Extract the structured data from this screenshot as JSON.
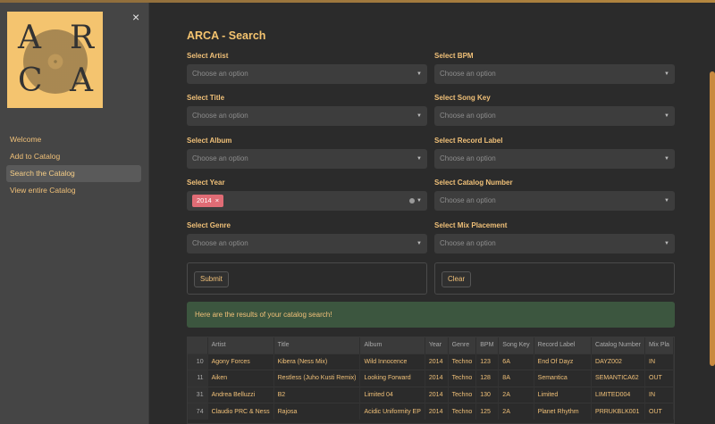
{
  "sidebar": {
    "logo_letters": [
      "A",
      "R",
      "C",
      "A"
    ],
    "nav": [
      {
        "label": "Welcome"
      },
      {
        "label": "Add to Catalog"
      },
      {
        "label": "Search the Catalog"
      },
      {
        "label": "View entire Catalog"
      }
    ],
    "close_icon": "×"
  },
  "main": {
    "title": "ARCA - Search",
    "placeholder": "Choose an option",
    "left_fields": [
      {
        "label": "Select Artist"
      },
      {
        "label": "Select Title"
      },
      {
        "label": "Select Album"
      },
      {
        "label": "Select Year"
      },
      {
        "label": "Select Genre"
      }
    ],
    "right_fields": [
      {
        "label": "Select BPM"
      },
      {
        "label": "Select Song Key"
      },
      {
        "label": "Select Record Label"
      },
      {
        "label": "Select Catalog Number"
      },
      {
        "label": "Select Mix Placement"
      }
    ],
    "year_tag": "2014",
    "submit_label": "Submit",
    "clear_label": "Clear",
    "success_message": "Here are the results of your catalog search!"
  },
  "table": {
    "columns": [
      "",
      "Artist",
      "Title",
      "Album",
      "Year",
      "Genre",
      "BPM",
      "Song Key",
      "Record Label",
      "Catalog Number",
      "Mix Pla"
    ],
    "rows": [
      [
        "10",
        "Agony Forces",
        "Kibera (Ness Mix)",
        "Wild Innocence",
        "2014",
        "Techno",
        "123",
        "6A",
        "End Of Dayz",
        "DAYZ002",
        "IN"
      ],
      [
        "11",
        "Aiken",
        "Restless (Juho Kusti Remix)",
        "Looking Forward",
        "2014",
        "Techno",
        "128",
        "8A",
        "Semantica",
        "SEMANTICA62",
        "OUT"
      ],
      [
        "31",
        "Andrea Belluzzi",
        "B2",
        "Limited 04",
        "2014",
        "Techno",
        "130",
        "2A",
        "Limited",
        "LIMITED004",
        "IN"
      ],
      [
        "74",
        "Claudio PRC & Ness",
        "Rajosa",
        "Acidic Uniformity EP",
        "2014",
        "Techno",
        "125",
        "2A",
        "Planet Rhythm",
        "PRRUKBLK001",
        "OUT"
      ]
    ]
  },
  "colors": {
    "accent": "#f0c078",
    "background": "#2b2b2b",
    "sidebar": "#454545",
    "success": "#3c563f",
    "tag": "#e06c75"
  }
}
